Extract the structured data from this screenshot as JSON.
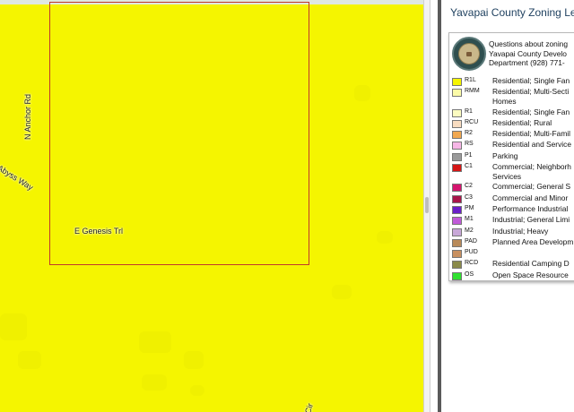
{
  "map": {
    "roads": {
      "anchor": "N Anchor Rd",
      "abyss": "E Abyss Way",
      "genesis": "E Genesis Trl",
      "cir": "Cir"
    },
    "colors": {
      "fill": "#f5f500",
      "parcel_border": "#c0392b"
    }
  },
  "legend": {
    "title": "Yavapai County Zoning Le",
    "contact_line1": "Questions about zoning",
    "contact_line2": "Yavapai County Develo",
    "contact_line3": "Department (928) 771-",
    "items": [
      {
        "code": "R1L",
        "label": "Residential; Single Fan",
        "color": "#f5f500"
      },
      {
        "code": "RMM",
        "label": "Residential; Multi-Secti",
        "label2": "Homes",
        "color": "#fbfba8"
      },
      {
        "code": "R1",
        "label": "Residential; Single Fan",
        "color": "#fbfbc0"
      },
      {
        "code": "RCU",
        "label": "Residential; Rural",
        "color": "#f8dcc0"
      },
      {
        "code": "R2",
        "label": "Residential; Multi-Famil",
        "color": "#f1a850"
      },
      {
        "code": "RS",
        "label": "Residential and Service",
        "color": "#f6b6e6"
      },
      {
        "code": "P1",
        "label": "Parking",
        "color": "#9a9a9a"
      },
      {
        "code": "C1",
        "label": "Commercial; Neighborh",
        "label2": "Services",
        "color": "#d41515"
      },
      {
        "code": "C2",
        "label": "Commercial; General S",
        "color": "#d4156e"
      },
      {
        "code": "C3",
        "label": "Commercial and Minor",
        "color": "#a8154a"
      },
      {
        "code": "PM",
        "label": "Performance Industrial",
        "color": "#6a1fc8"
      },
      {
        "code": "M1",
        "label": "Industrial; General Limi",
        "color": "#c05ad8"
      },
      {
        "code": "M2",
        "label": "Industrial; Heavy",
        "color": "#c8a8d8"
      },
      {
        "code": "PAD",
        "label": "Planned Area Developm",
        "color": "#b88a5a"
      },
      {
        "code": "PUD",
        "label": "",
        "color": "#c89060"
      },
      {
        "code": "RCD",
        "label": "Residential Camping D",
        "color": "#8a8a4a"
      },
      {
        "code": "OS",
        "label": "Open Space Resource",
        "color": "#30e030"
      }
    ]
  }
}
